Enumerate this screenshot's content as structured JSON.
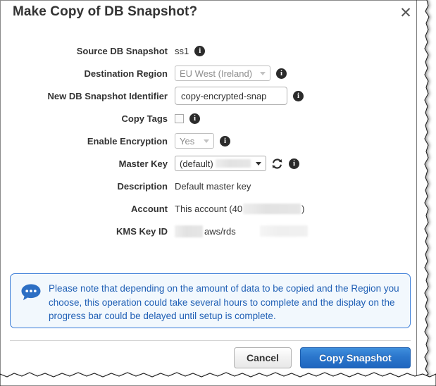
{
  "dialog": {
    "title": "Make Copy of DB Snapshot?",
    "close_icon": "close-icon",
    "close_glyph": "✕"
  },
  "form": {
    "rows": [
      {
        "label": "Source DB Snapshot",
        "type": "text",
        "value": "ss1",
        "info": true
      },
      {
        "label": "Destination Region",
        "type": "select",
        "value": "EU West (Ireland)",
        "disabled": true,
        "info": true
      },
      {
        "label": "New DB Snapshot Identifier",
        "type": "input",
        "value": "copy-encrypted-snap",
        "placeholder": "",
        "info": true
      },
      {
        "label": "Copy Tags",
        "type": "checkbox",
        "checked": false,
        "info": true
      },
      {
        "label": "Enable Encryption",
        "type": "select",
        "value": "Yes",
        "disabled": true,
        "info": true
      },
      {
        "label": "Master Key",
        "type": "select",
        "value": "(default)",
        "redacted": true,
        "disabled": false,
        "refresh": true,
        "info": true
      },
      {
        "label": "Description",
        "type": "text",
        "value": "Default master key",
        "info": false
      },
      {
        "label": "Account",
        "type": "text",
        "value_prefix": "This account (40",
        "value_suffix": ")",
        "redacted": true,
        "info": false
      },
      {
        "label": "KMS Key ID",
        "type": "text",
        "value_suffix": "aws/rds",
        "redacted": true,
        "info": false
      }
    ]
  },
  "note": {
    "icon": "speech-bubble-icon",
    "text": "Please note that depending on the amount of data to be copied and the Region you choose, this operation could take several hours to complete and the display on the progress bar could be delayed until setup is complete.",
    "accent_color": "#3b7dd8",
    "background_color": "#f2f8fd",
    "text_color": "#1f5fb5"
  },
  "footer": {
    "cancel_label": "Cancel",
    "copy_label": "Copy Snapshot",
    "primary_color": "#2b76cc"
  }
}
